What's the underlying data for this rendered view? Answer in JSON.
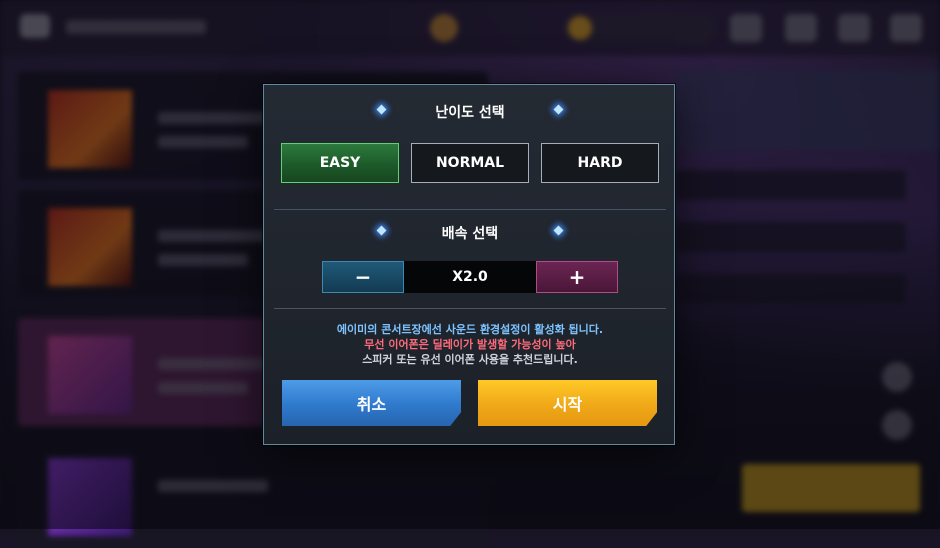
{
  "dialog": {
    "difficulty_title": "난이도 선택",
    "difficulty_options": [
      "EASY",
      "NORMAL",
      "HARD"
    ],
    "selected_difficulty": "EASY",
    "speed_title": "배속 선택",
    "speed_minus_label": "−",
    "speed_value": "X2.0",
    "speed_plus_label": "+",
    "notice_lines": [
      "에이미의 콘서트장에선 사운드 환경설정이 활성화 됩니다.",
      "무선 이어폰은 딜레이가 발생할 가능성이 높아",
      "스피커 또는 유선 이어폰 사용을 추천드립니다."
    ],
    "cancel_label": "취소",
    "start_label": "시작"
  },
  "colors": {
    "easy_selected": "#2c7a3c",
    "cancel_button": "#3a86d8",
    "start_button": "#f5b21e",
    "notice_blue": "#7ec3ff",
    "notice_pink": "#ff6b7a",
    "notice_gray": "#cfd3da"
  }
}
